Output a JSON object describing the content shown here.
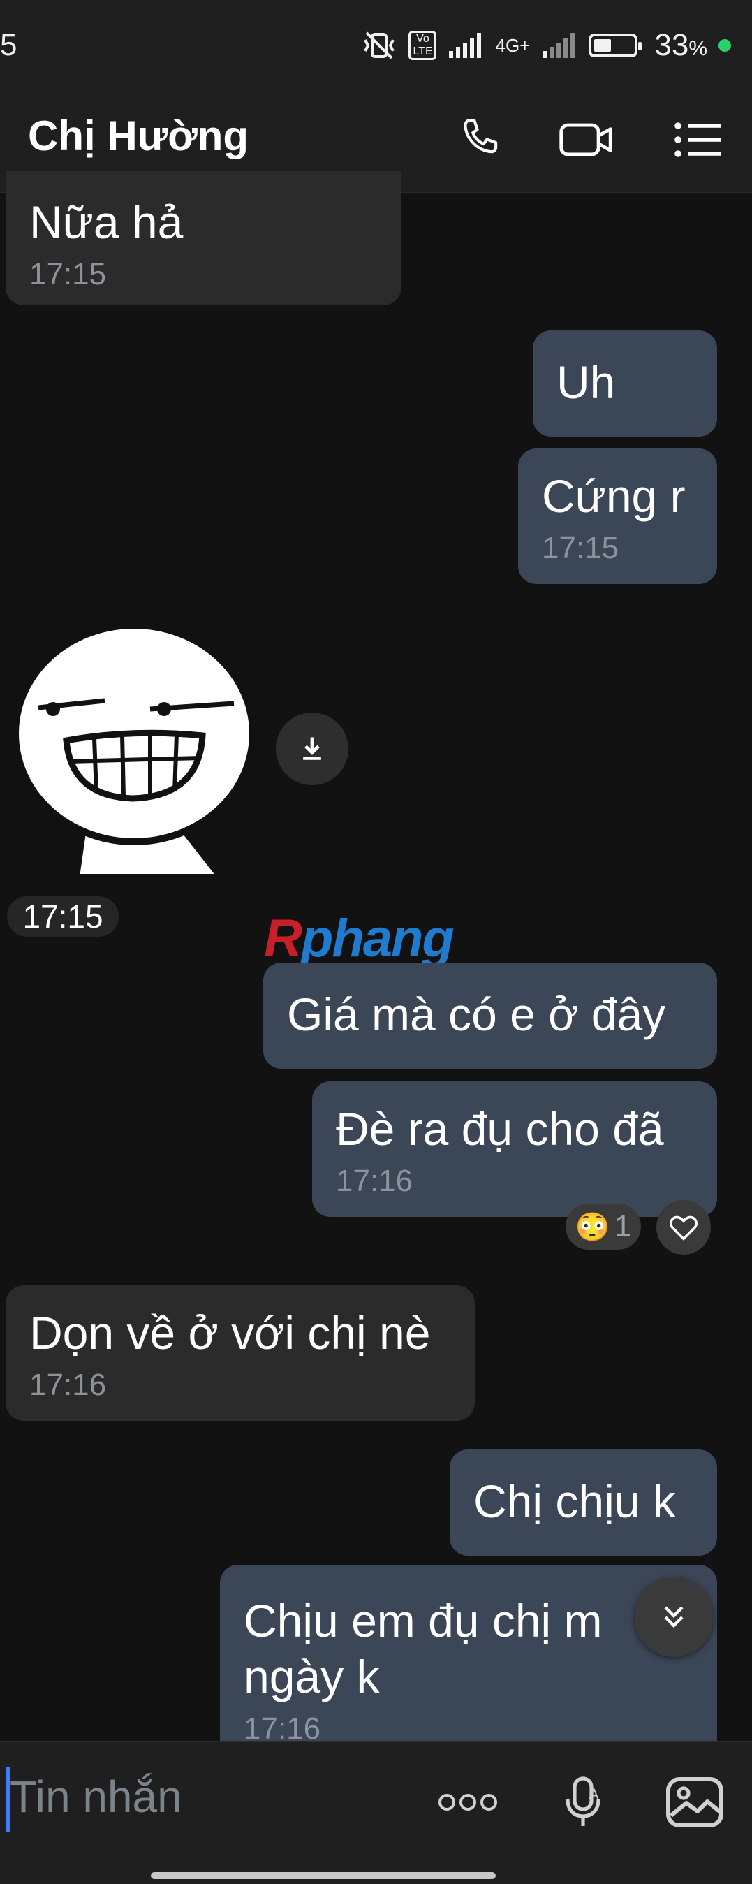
{
  "status_bar": {
    "time": "5",
    "network": "4G+",
    "volte": "Vo LTE",
    "battery": "33",
    "battery_unit": "%"
  },
  "header": {
    "contact_name": "Chị Hường"
  },
  "messages": [
    {
      "dir": "received",
      "text": "Nữa hả",
      "time": "17:15"
    },
    {
      "dir": "sent",
      "text": "Uh"
    },
    {
      "dir": "sent",
      "text": "Cứng r",
      "time": "17:15"
    },
    {
      "dir": "received",
      "type": "sticker",
      "time": "17:15"
    },
    {
      "dir": "sent",
      "text": "Giá mà có e ở đây"
    },
    {
      "dir": "sent",
      "text": "Đè ra đụ cho đã",
      "time": "17:16",
      "reaction": {
        "emoji": "😳",
        "count": "1"
      }
    },
    {
      "dir": "received",
      "text": "Dọn về ở với chị nè",
      "time": "17:16"
    },
    {
      "dir": "sent",
      "text": "Chị chịu k"
    },
    {
      "dir": "sent",
      "text_line1": "Chịu em đụ chị m",
      "text_line2": "ngày k",
      "time": "17:16"
    }
  ],
  "watermark": {
    "letter": "R",
    "rest": "phang"
  },
  "composer": {
    "placeholder": "Tin nhắn"
  },
  "colors": {
    "sent_bubble": "#3b4656",
    "received_bubble": "#2b2b2b",
    "accent": "#3d7eff",
    "online": "#28d36a"
  }
}
